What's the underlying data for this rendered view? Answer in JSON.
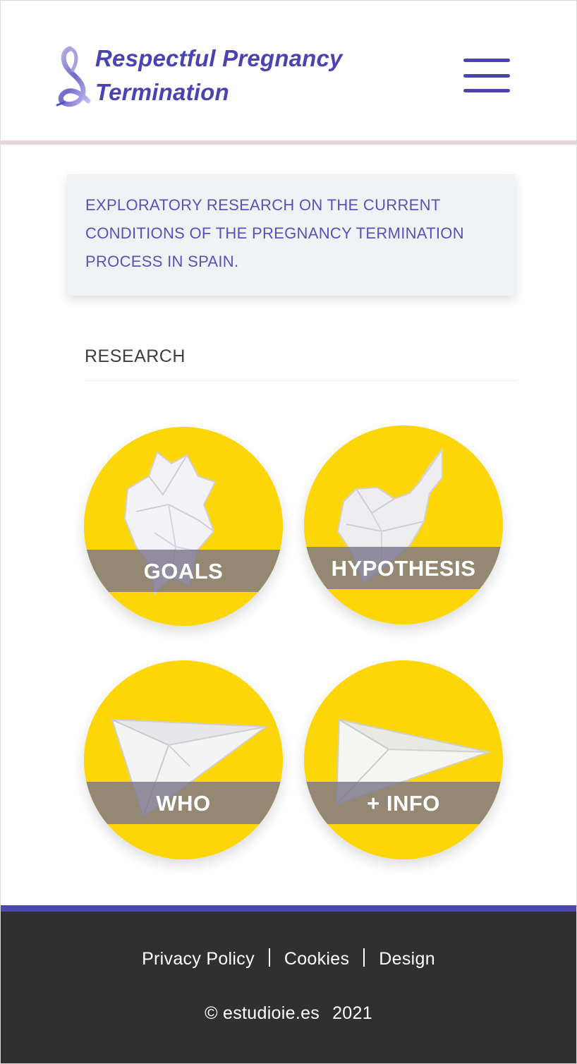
{
  "header": {
    "logo_line1": "Respectful Pregnancy",
    "logo_line2": "Termination",
    "menu_icon": "hamburger-menu-icon",
    "brand_color": "#4a44b2"
  },
  "intro": {
    "text": "EXPLORATORY RESEARCH ON THE CURRENT CONDITIONS OF THE PREGNANCY TERMINATION PROCESS IN SPAIN."
  },
  "section": {
    "title": "RESEARCH"
  },
  "tiles": [
    {
      "label": "GOALS",
      "icon": "crumpled-paper-icon"
    },
    {
      "label": "HYPOTHESIS",
      "icon": "crumpled-paper-icon"
    },
    {
      "label": "WHO",
      "icon": "paper-plane-icon"
    },
    {
      "label": "+ INFO",
      "icon": "paper-plane-icon"
    }
  ],
  "colors": {
    "tile_yellow": "#fdd607",
    "footer_bg": "#303030",
    "footer_accent": "#4c48ac",
    "header_rule": "#e6d3e2"
  },
  "footer": {
    "links": [
      "Privacy Policy",
      "Cookies",
      "Design"
    ],
    "copyright": "© estudioie.es",
    "year": "2021"
  }
}
